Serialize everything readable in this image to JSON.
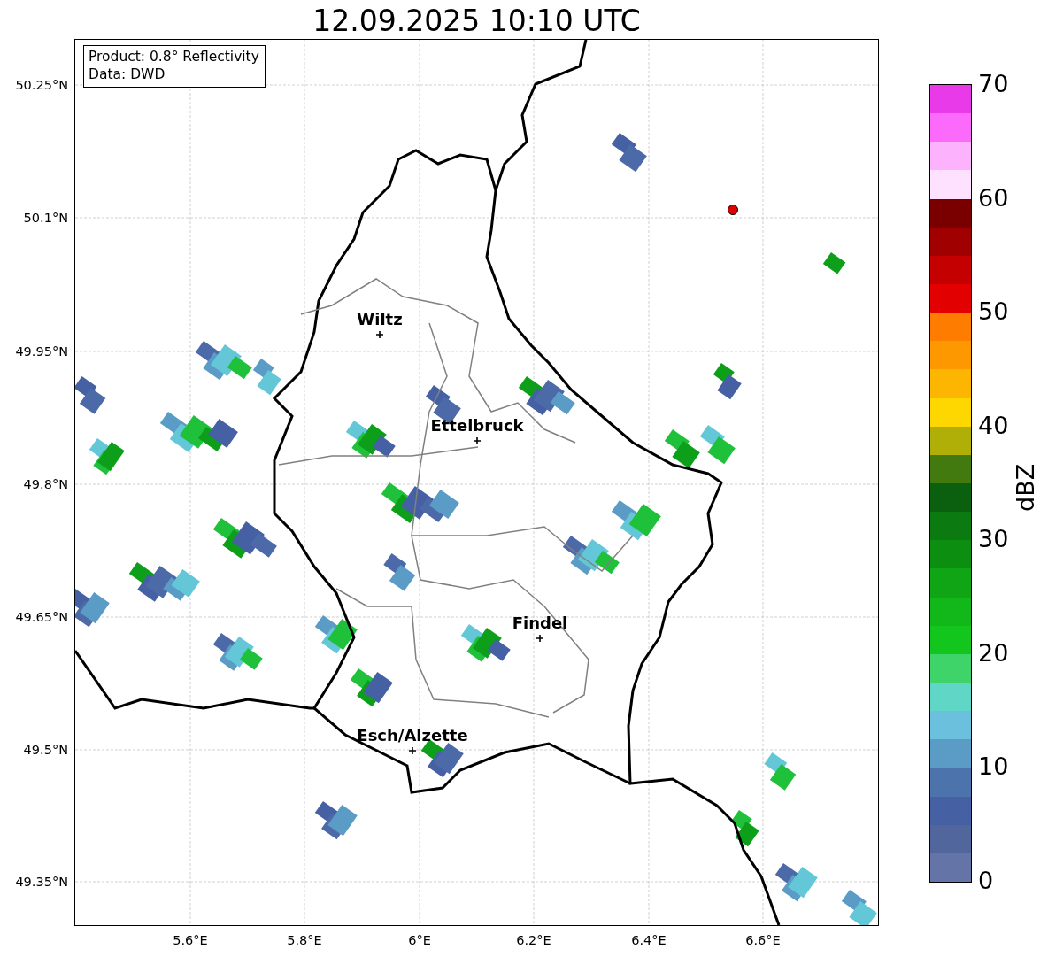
{
  "title": "12.09.2025 10:10 UTC",
  "info_box": {
    "lines": [
      "Product: 0.8° Reflectivity",
      "Data: DWD"
    ]
  },
  "map": {
    "cities": [
      {
        "name": "Wiltz"
      },
      {
        "name": "Ettelbruck"
      },
      {
        "name": "Findel"
      },
      {
        "name": "Esch/Alzette"
      }
    ],
    "lat_ticks": [
      "50.25°N",
      "50.1°N",
      "49.95°N",
      "49.8°N",
      "49.65°N",
      "49.5°N",
      "49.35°N"
    ],
    "lon_ticks": [
      "5.6°E",
      "5.8°E",
      "6°E",
      "6.2°E",
      "6.4°E",
      "6.6°E"
    ]
  },
  "colorbar": {
    "label": "dBZ",
    "ticks": [
      "70",
      "60",
      "50",
      "40",
      "30",
      "20",
      "10",
      "0"
    ],
    "bands": [
      {
        "color": "#e83ae8"
      },
      {
        "color": "#fc6afc"
      },
      {
        "color": "#fdb2fd"
      },
      {
        "color": "#fde1fe"
      },
      {
        "color": "#7a0000"
      },
      {
        "color": "#a00000"
      },
      {
        "color": "#c40000"
      },
      {
        "color": "#e30000"
      },
      {
        "color": "#fe7d00"
      },
      {
        "color": "#fe9800"
      },
      {
        "color": "#fcb500"
      },
      {
        "color": "#fed700"
      },
      {
        "color": "#afaf08"
      },
      {
        "color": "#437a10"
      },
      {
        "color": "#0b6010"
      },
      {
        "color": "#0b7a10"
      },
      {
        "color": "#0c8f10"
      },
      {
        "color": "#10a514"
      },
      {
        "color": "#12b81a"
      },
      {
        "color": "#12c61e"
      },
      {
        "color": "#3ed46a"
      },
      {
        "color": "#5fd6c6"
      },
      {
        "color": "#6bc1dd"
      },
      {
        "color": "#5a9cc6"
      },
      {
        "color": "#4d73ad"
      },
      {
        "color": "#4660a4"
      },
      {
        "color": "#52669e"
      },
      {
        "color": "#6474a6"
      }
    ]
  }
}
